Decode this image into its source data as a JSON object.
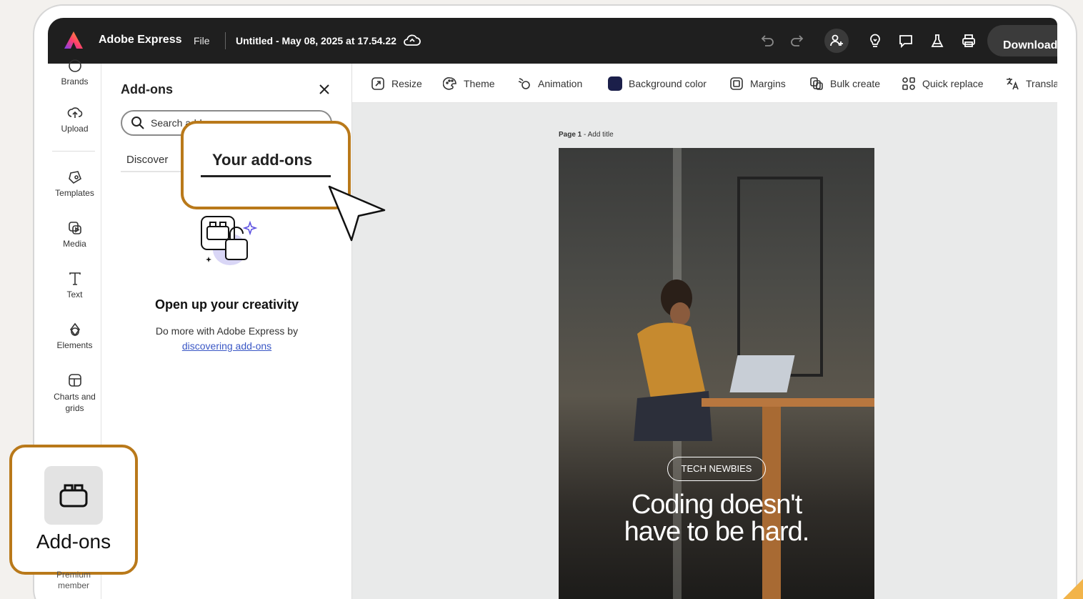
{
  "colors": {
    "topbar_bg": "#1f1f1f",
    "callout_border": "#b9791a",
    "link": "#3a57c5",
    "background_swatch": "#1b1f4a"
  },
  "topbar": {
    "app_title": "Adobe Express",
    "file_menu": "File",
    "doc_title": "Untitled - May 08, 2025 at 17.54.22",
    "download_label": "Download"
  },
  "rail": {
    "items": [
      {
        "label": "Brands",
        "icon": "brands-icon"
      },
      {
        "label": "Upload",
        "icon": "upload-icon"
      },
      {
        "label": "Templates",
        "icon": "templates-icon"
      },
      {
        "label": "Media",
        "icon": "media-icon"
      },
      {
        "label": "Text",
        "icon": "text-icon"
      },
      {
        "label": "Elements",
        "icon": "elements-icon"
      },
      {
        "label": "Charts and grids",
        "icon": "charts-grids-icon"
      }
    ],
    "premium_label": "Premium member"
  },
  "panel": {
    "title": "Add-ons",
    "search_value": "Search add-ons",
    "tabs": {
      "discover": "Discover",
      "your_addons": "Your add-ons"
    },
    "empty_heading": "Open up your creativity",
    "empty_text": "Do more with Adobe Express by",
    "empty_link": "discovering add-ons"
  },
  "toolbar": {
    "items": [
      {
        "label": "Resize",
        "icon": "resize-icon"
      },
      {
        "label": "Theme",
        "icon": "theme-icon"
      },
      {
        "label": "Animation",
        "icon": "animation-icon"
      },
      {
        "label": "Background color",
        "icon": "background-color-swatch"
      },
      {
        "label": "Margins",
        "icon": "margins-icon"
      },
      {
        "label": "Bulk create",
        "icon": "bulk-create-icon"
      },
      {
        "label": "Quick replace",
        "icon": "quick-replace-icon"
      },
      {
        "label": "Translate",
        "icon": "translate-icon"
      }
    ]
  },
  "canvas": {
    "page_label_bold": "Page 1",
    "page_label_rest": " - Add title",
    "tag": "TECH NEWBIES",
    "headline_line1": "Coding doesn't",
    "headline_line2": "have to be hard."
  },
  "callouts": {
    "tab_label": "Your add-ons",
    "rail_label": "Add-ons"
  }
}
